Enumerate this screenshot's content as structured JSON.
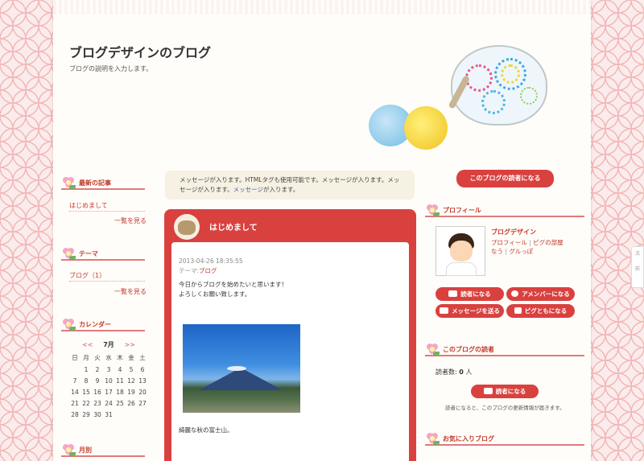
{
  "header": {
    "title": "ブログデザインのブログ",
    "description": "ブログの説明を入力します。"
  },
  "left": {
    "recent": {
      "title": "最新の記事",
      "items": [
        "はじめまして"
      ],
      "more": "一覧を見る"
    },
    "theme": {
      "title": "テーマ",
      "items": [
        "ブログ（1）"
      ],
      "more": "一覧を見る"
    },
    "calendar": {
      "title": "カレンダー",
      "prev": "<<",
      "month": "7月",
      "next": ">>",
      "weekdays": [
        "日",
        "月",
        "火",
        "水",
        "木",
        "金",
        "土"
      ],
      "days": [
        "",
        "1",
        "2",
        "3",
        "4",
        "5",
        "6",
        "7",
        "8",
        "9",
        "10",
        "11",
        "12",
        "13",
        "14",
        "15",
        "16",
        "17",
        "18",
        "19",
        "20",
        "21",
        "22",
        "23",
        "24",
        "25",
        "26",
        "27",
        "28",
        "29",
        "30",
        "31",
        "",
        "",
        ""
      ]
    },
    "monthly": {
      "title": "月別"
    }
  },
  "main": {
    "message": {
      "text1": "メッセージが入ります。HTMLタグも使用可能です。メッセージが入ります。メッ",
      "text2": "セージが入ります。",
      "link": "メッセージ",
      "text3": "が入ります。"
    },
    "entry": {
      "title": "はじめまして",
      "datetime": "2013-04-26 18:35:55",
      "theme_label": "テーマ:",
      "theme": "ブログ",
      "line1": "今日からブログを始めたいと思います！",
      "line2": "よろしくお願い致します。",
      "caption": "綺麗な秋の富士山。"
    }
  },
  "right": {
    "reader_button": "このブログの読者になる",
    "profile": {
      "title": "プロフィール",
      "name": "ブログデザイン",
      "link1": "プロフィール",
      "link2": "ピグの部屋",
      "link3": "なう",
      "link4": "グルっぽ",
      "sep": "|"
    },
    "buttons": {
      "reader": "読者になる",
      "member": "アメンバーになる",
      "message": "メッセージを送る",
      "pig": "ピグともになる"
    },
    "readers": {
      "title": "このブログの読者",
      "count_label": "読者数:",
      "count": "0",
      "unit": "人",
      "button": "読者になる",
      "note": "読者になると、このブログの更新情報が届きます。"
    },
    "favorites": {
      "title": "お気に入りブログ"
    }
  },
  "edge": {
    "label1": "次",
    "label2": "前"
  },
  "colors": {
    "accent": "#d9413f",
    "link": "#c0392b",
    "paper": "#fffdf9",
    "background_pattern": "#f2b7b7"
  }
}
